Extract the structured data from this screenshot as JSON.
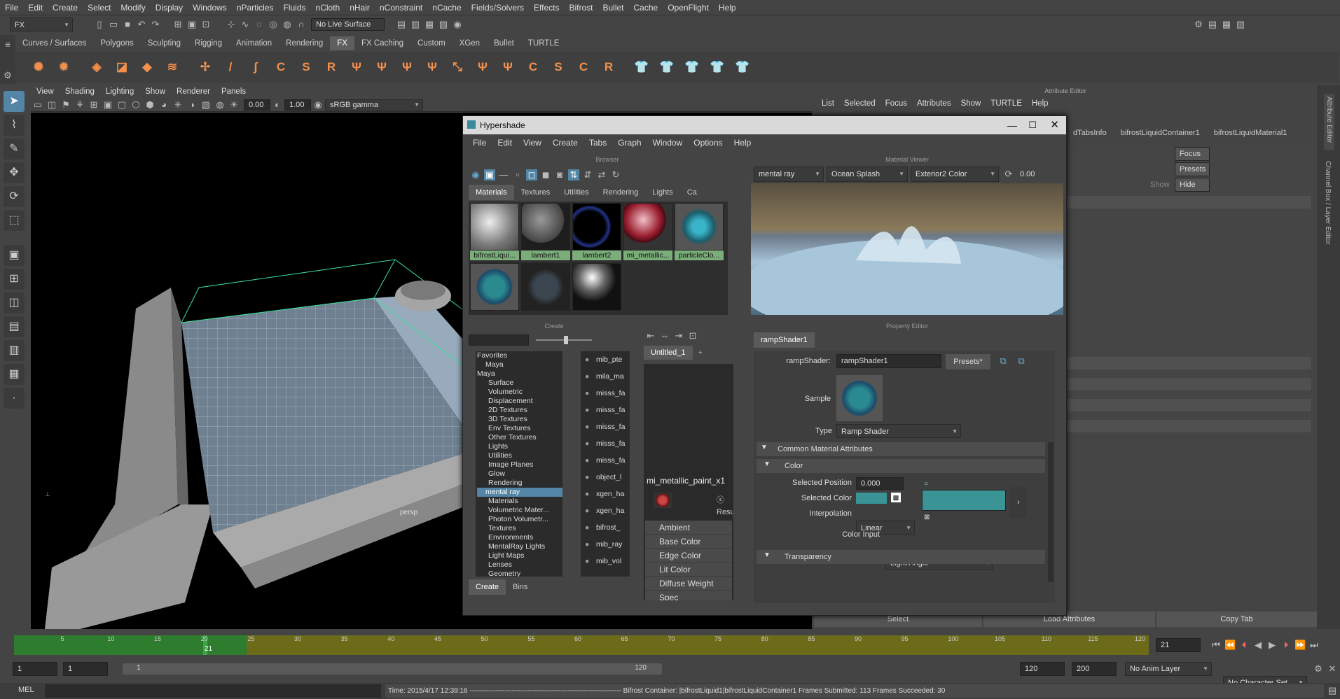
{
  "menubar": {
    "items": [
      "File",
      "Edit",
      "Create",
      "Select",
      "Modify",
      "Display",
      "Windows",
      "nParticles",
      "Fluids",
      "nCloth",
      "nHair",
      "nConstraint",
      "nCache",
      "Fields/Solvers",
      "Effects",
      "Bifrost",
      "Bullet",
      "Cache",
      "OpenFlight",
      "Help"
    ]
  },
  "status": {
    "menuset": "FX",
    "live_surface": "No Live Surface"
  },
  "shelf": {
    "tabs": [
      "Curves / Surfaces",
      "Polygons",
      "Sculpting",
      "Rigging",
      "Animation",
      "Rendering",
      "FX",
      "FX Caching",
      "Custom",
      "XGen",
      "Bullet",
      "TURTLE"
    ],
    "active": "FX"
  },
  "viewport": {
    "menu": [
      "View",
      "Shading",
      "Lighting",
      "Show",
      "Renderer",
      "Panels"
    ],
    "near": "0.00",
    "far": "1.00",
    "colorspace": "sRGB gamma",
    "camera": "persp"
  },
  "hypershade": {
    "title": "Hypershade",
    "menu": [
      "File",
      "Edit",
      "View",
      "Create",
      "Tabs",
      "Graph",
      "Window",
      "Options",
      "Help"
    ],
    "browser": {
      "header": "Browser",
      "tabs": [
        "Materials",
        "Textures",
        "Utilities",
        "Rendering",
        "Lights",
        "Ca"
      ],
      "swatches": [
        "bifrostLiqui...",
        "lambert1",
        "lambert2",
        "mi_metallic...",
        "particleClo..."
      ]
    },
    "material_viewer": {
      "header": "Material Viewer",
      "renderer": "mental ray",
      "scene": "Ocean Splash",
      "env": "Exterior2 Color",
      "value": "0.00"
    },
    "create": {
      "header": "Create",
      "tree": [
        "Favorites",
        "Maya",
        "Maya",
        "Surface",
        "Volumetric",
        "Displacement",
        "2D Textures",
        "3D Textures",
        "Env Textures",
        "Other Textures",
        "Lights",
        "Utilities",
        "Image Planes",
        "Glow",
        "Rendering",
        "mental ray",
        "Materials",
        "Volumetric Mater...",
        "Photon Volumetr...",
        "Textures",
        "Environments",
        "MentalRay Lights",
        "Light Maps",
        "Lenses",
        "Geometry"
      ],
      "nodes": [
        "mib_pte",
        "mila_ma",
        "misss_fa",
        "misss_fa",
        "misss_fa",
        "misss_fa",
        "misss_fa",
        "object_l",
        "xgen_ha",
        "xgen_ha",
        "bifrost_",
        "mib_ray",
        "mib_vol"
      ],
      "bottom_tabs": [
        "Create",
        "Bins"
      ]
    },
    "graph": {
      "tab": "Untitled_1",
      "node_title": "mi_metallic_paint_x1",
      "result": "Resu",
      "attrs": [
        "Ambient",
        "Base Color",
        "Edge Color",
        "Lit Color",
        "Diffuse Weight",
        "Spec"
      ]
    },
    "property": {
      "header": "Property Editor",
      "tab": "rampShader1",
      "shader_label": "rampShader:",
      "shader_name": "rampShader1",
      "presets": "Presets*",
      "sample_label": "Sample",
      "type_label": "Type",
      "type_value": "Ramp Shader",
      "section1": "Common Material Attributes",
      "section2": "Color",
      "sel_pos_label": "Selected Position",
      "sel_pos_value": "0.000",
      "sel_color_label": "Selected Color",
      "interp_label": "Interpolation",
      "interp_value": "Linear",
      "color_input_label": "Color Input",
      "color_input_value": "Light Angle",
      "section3": "Transparency"
    }
  },
  "attribute_editor": {
    "title": "Attribute Editor",
    "menu": [
      "List",
      "Selected",
      "Focus",
      "Attributes",
      "Show",
      "TURTLE",
      "Help"
    ],
    "tabs": [
      "dTabsInfo",
      "bifrostLiquidContainer1",
      "bifrostLiquidMaterial1"
    ],
    "focus": "Focus",
    "presets": "Presets",
    "show": "Show",
    "hide": "Hide",
    "bottom": [
      "Select",
      "Load Attributes",
      "Copy Tab"
    ]
  },
  "side_labels": [
    "Attribute Editor",
    "Channel Box / Layer Editor"
  ],
  "timeline": {
    "ticks": [
      "5",
      "10",
      "15",
      "20",
      "25",
      "30",
      "35",
      "40",
      "45",
      "50",
      "55",
      "60",
      "65",
      "70",
      "75",
      "80",
      "85",
      "90",
      "95",
      "100",
      "105",
      "110",
      "115",
      "120"
    ],
    "current": "21",
    "current_field": "21"
  },
  "range": {
    "start": "1",
    "inner_start": "1",
    "slider_start": "1",
    "slider_end": "120",
    "end": "120",
    "max": "200",
    "anim_layer": "No Anim Layer",
    "char_set": "No Character Set"
  },
  "cmdline": {
    "lang": "MEL",
    "message": "Time: 2015/4/17 12:39:16 ----------------------------------------------------------------- Bifrost Container: |bifrostLiquid1|bifrostLiquidContainer1 Frames Submitted: 113 Frames Succeeded: 30"
  }
}
